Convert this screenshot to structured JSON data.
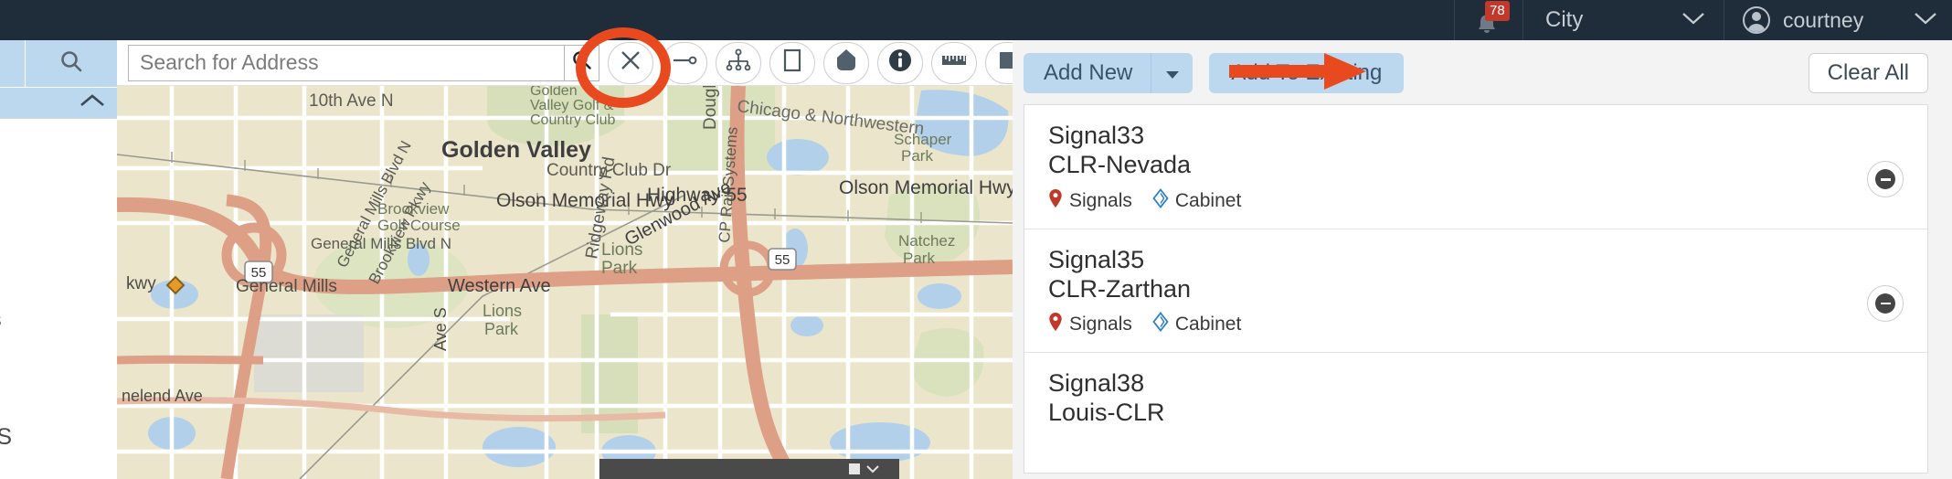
{
  "topbar": {
    "notifications": {
      "icon": "bell-icon",
      "count": "78"
    },
    "org_selector": {
      "label": "City",
      "icon": "chevron-down-icon"
    },
    "user_menu": {
      "label": "courtney",
      "icon": "chevron-down-icon",
      "avatar": "avatar-icon"
    }
  },
  "sidebar": {
    "search_icon": "search-icon",
    "collapse_icon": "chevron-up-icon",
    "labels": [
      {
        "text": "rs"
      },
      {
        "text": "LS"
      }
    ]
  },
  "search": {
    "placeholder": "Search for Address",
    "value": "",
    "submit_icon": "search-icon"
  },
  "toolbar": {
    "buttons": [
      {
        "name": "clear-selection-tool",
        "icon": "close-x-icon"
      },
      {
        "name": "measure-line-tool",
        "icon": "line-endpoint-icon"
      },
      {
        "name": "network-tool",
        "icon": "network-tree-icon"
      },
      {
        "name": "select-rectangle-tool",
        "icon": "rectangle-outline-icon"
      },
      {
        "name": "polygon-tool",
        "icon": "polygon-filled-icon"
      },
      {
        "name": "info-tool",
        "icon": "info-icon"
      },
      {
        "name": "ruler-tool",
        "icon": "ruler-icon"
      },
      {
        "name": "fill-rectangle-tool",
        "icon": "square-filled-icon"
      },
      {
        "name": "circle-tool",
        "icon": "circle-filled-icon"
      }
    ]
  },
  "map": {
    "place_labels": [
      "10th Ave N",
      "Golden Valley",
      "Country Club Dr",
      "Douglas Dr",
      "Chicago & Northwestern",
      "Schaper Park",
      "Olson Memorial Hwy",
      "Highway 55",
      "Olson Memorial Hwy",
      "Brookview Golf Course",
      "General Mills Blvd N",
      "Brookview Pkwy",
      "Western Ave",
      "Ridgeway Rd",
      "Lions Park",
      "Glenwood Ave",
      "Natchez Park",
      "General Mills",
      "CP Rail Systems",
      "Golden Valley Golf & Country Club",
      "kwy",
      "nelend Ave",
      "Ave S"
    ],
    "route_shields": [
      "55",
      "55",
      "55"
    ]
  },
  "panel": {
    "add_new_label": "Add New",
    "add_new_caret_icon": "caret-down-icon",
    "add_to_existing_label": "Add To Existing",
    "clear_all_label": "Clear All",
    "items": [
      {
        "name": "Signal33",
        "description": "CLR-Nevada",
        "tags": [
          {
            "label": "Signals",
            "icon": "map-pin-icon",
            "color": "#c0392b"
          },
          {
            "label": "Cabinet",
            "icon": "diamond-icon",
            "color": "#2f80c7"
          }
        ],
        "remove_icon": "minus-circle-icon"
      },
      {
        "name": "Signal35",
        "description": "CLR-Zarthan",
        "tags": [
          {
            "label": "Signals",
            "icon": "map-pin-icon",
            "color": "#c0392b"
          },
          {
            "label": "Cabinet",
            "icon": "diamond-icon",
            "color": "#2f80c7"
          }
        ],
        "remove_icon": "minus-circle-icon"
      },
      {
        "name": "Signal38",
        "description": "Louis-CLR",
        "tags": [],
        "remove_icon": "minus-circle-icon"
      }
    ]
  },
  "annotations": {
    "highlight_circle": {
      "target": "clear-selection-tool",
      "color": "#e8491f"
    },
    "pointer_arrow": {
      "target": "clear-all-button",
      "color": "#e8491f"
    }
  },
  "colors": {
    "topbar_bg": "#1f2d3a",
    "accent_blue": "#bcd8ef",
    "annotation_red": "#e8491f",
    "badge_red": "#c0392b"
  }
}
